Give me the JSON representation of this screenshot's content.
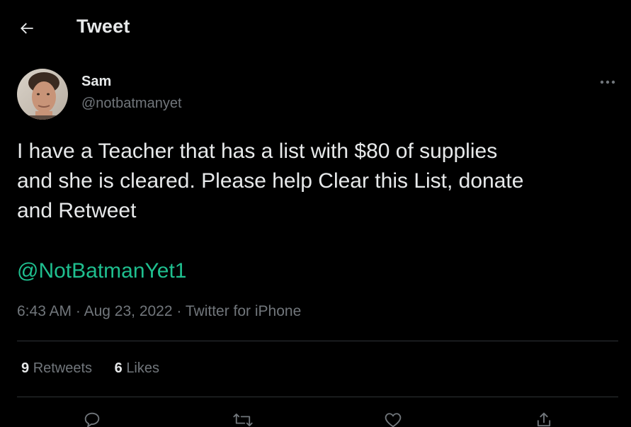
{
  "header": {
    "title": "Tweet",
    "back_icon": "arrow-left-icon"
  },
  "tweet": {
    "author": {
      "name": "Sam",
      "handle": "@notbatmanyet"
    },
    "text": "I have a Teacher that has a list with $80 of supplies\nand she is cleared. Please help Clear this List, donate\nand Retweet",
    "mention": "@NotBatmanYet1",
    "time": "6:43 AM",
    "separator": "·",
    "date": "Aug 23, 2022",
    "source": "Twitter for iPhone",
    "more_icon": "more-horizontal-icon"
  },
  "stats": {
    "retweets_count": "9",
    "retweets_label": "Retweets",
    "likes_count": "6",
    "likes_label": "Likes"
  },
  "actions": {
    "reply_icon": "reply-icon",
    "retweet_icon": "retweet-icon",
    "like_icon": "heart-icon",
    "share_icon": "share-icon"
  },
  "colors": {
    "background": "#000000",
    "text_primary": "#e7e9ea",
    "text_secondary": "#71767b",
    "mention": "#1fbf8f",
    "divider": "#2f3336"
  }
}
